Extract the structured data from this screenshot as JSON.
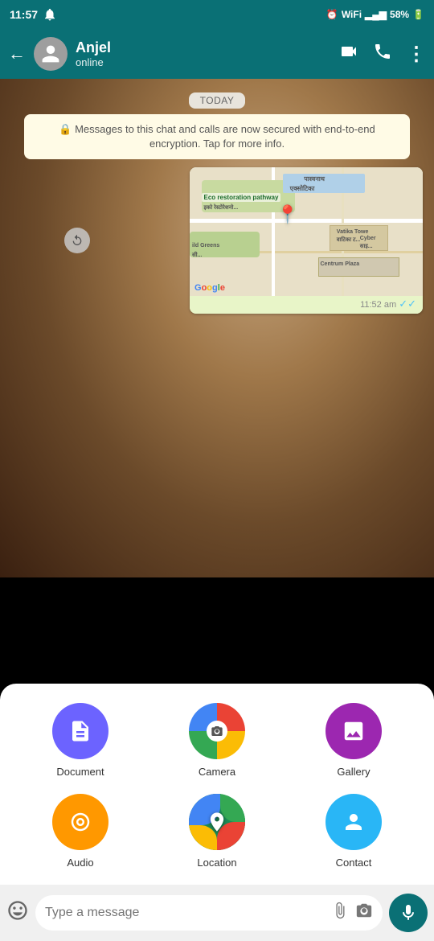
{
  "statusBar": {
    "time": "11:57",
    "battery": "58%",
    "signal": "VoLTE"
  },
  "header": {
    "contactName": "Anjel",
    "contactStatus": "online",
    "backLabel": "←",
    "videoCallLabel": "📹",
    "callLabel": "📞",
    "menuLabel": "⋮"
  },
  "chat": {
    "dateBadge": "TODAY",
    "encryptionNotice": "🔒 Messages to this chat and calls are now secured with end-to-end encryption. Tap for more info.",
    "mapTime": "11:52 am",
    "mapTicks": "✓✓",
    "mapLabel1": "पास्वनाथ एक्सोटिका",
    "mapLabel2": "Eco restoration pathway",
    "mapLabel3": "Vatika Towe",
    "mapLabel4": "ild Greens",
    "mapLabel5": "Centrum Plaza",
    "mapLabel6": "Cyber"
  },
  "attachmentMenu": {
    "items": [
      {
        "id": "document",
        "label": "Document",
        "icon": "📄",
        "colorClass": "icon-document"
      },
      {
        "id": "camera",
        "label": "Camera",
        "icon": "📷",
        "colorClass": "icon-camera"
      },
      {
        "id": "gallery",
        "label": "Gallery",
        "icon": "🖼️",
        "colorClass": "icon-gallery"
      },
      {
        "id": "audio",
        "label": "Audio",
        "icon": "🎧",
        "colorClass": "icon-audio"
      },
      {
        "id": "location",
        "label": "Location",
        "icon": "📍",
        "colorClass": "icon-location"
      },
      {
        "id": "contact",
        "label": "Contact",
        "icon": "👤",
        "colorClass": "icon-contact"
      }
    ]
  },
  "inputBar": {
    "placeholder": "Type a message",
    "emojiIcon": "😊",
    "clipIcon": "📎",
    "cameraIcon": "📷",
    "micIcon": "🎙️"
  },
  "sysNav": {
    "back": "◁",
    "home": "○",
    "recents": "▐▌"
  }
}
